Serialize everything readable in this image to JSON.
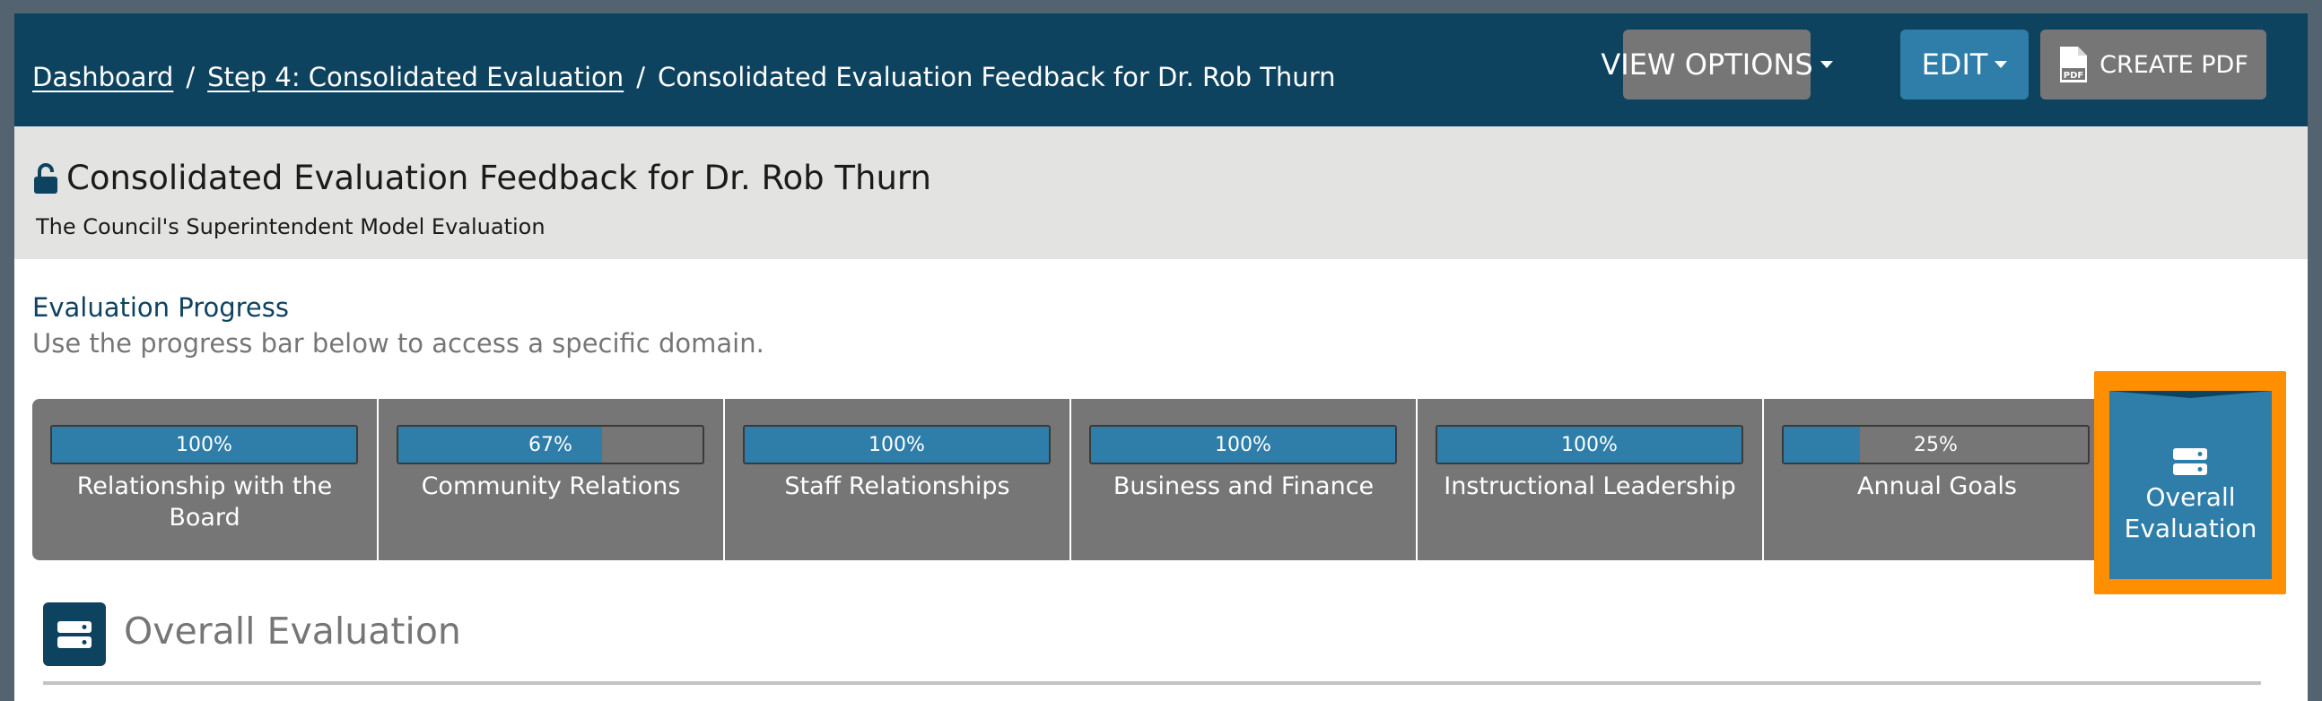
{
  "breadcrumb": {
    "items": [
      "Dashboard",
      "Step 4: Consolidated Evaluation"
    ],
    "current": "Consolidated Evaluation Feedback for Dr. Rob Thurn",
    "separator": "/"
  },
  "toolbar": {
    "view_options_label": "VIEW OPTIONS",
    "edit_label": "EDIT",
    "create_pdf_label": "CREATE PDF",
    "pdf_icon_text": "PDF"
  },
  "header": {
    "title": "Consolidated Evaluation Feedback for Dr. Rob Thurn",
    "subtitle": "The Council's Superintendent Model Evaluation"
  },
  "progress": {
    "heading": "Evaluation Progress",
    "description": "Use the progress bar below to access a specific domain.",
    "domains": [
      {
        "label": "Relationship with the Board",
        "percent_text": "100%",
        "percent": 100
      },
      {
        "label": "Community Relations",
        "percent_text": "67%",
        "percent": 67
      },
      {
        "label": "Staff Relationships",
        "percent_text": "100%",
        "percent": 100
      },
      {
        "label": "Business and Finance",
        "percent_text": "100%",
        "percent": 100
      },
      {
        "label": "Instructional Leadership",
        "percent_text": "100%",
        "percent": 100
      },
      {
        "label": "Annual Goals",
        "percent_text": "25%",
        "percent": 25
      }
    ],
    "overall_tab_label": "Overall Evaluation"
  },
  "section": {
    "title": "Overall Evaluation"
  },
  "colors": {
    "navy": "#0e4360",
    "accent_blue": "#2e7ea9",
    "gray": "#767676",
    "highlight_orange": "#ff8f00"
  }
}
